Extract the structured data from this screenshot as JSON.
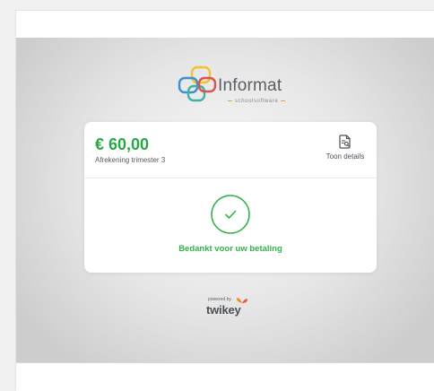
{
  "brand": {
    "name": "Informat",
    "tagline": "schoolsoftware",
    "colors": {
      "yellow": "#f2c230",
      "blue": "#3e8fd0",
      "red": "#d9534f",
      "teal": "#3bb3a6",
      "text": "#5a5f66"
    },
    "icon": "informat-logo-icon"
  },
  "payment": {
    "amount": "€ 60,00",
    "description": "Afrekening trimester 3",
    "details_label": "Toon details",
    "details_icon": "document-search-icon",
    "status_icon": "check-circle-icon",
    "status_message": "Bedankt voor uw betaling",
    "accent_color": "#28a745"
  },
  "footer": {
    "powered_by": "powered by",
    "provider": "twikey",
    "provider_icon": "twikey-butterfly-icon"
  }
}
